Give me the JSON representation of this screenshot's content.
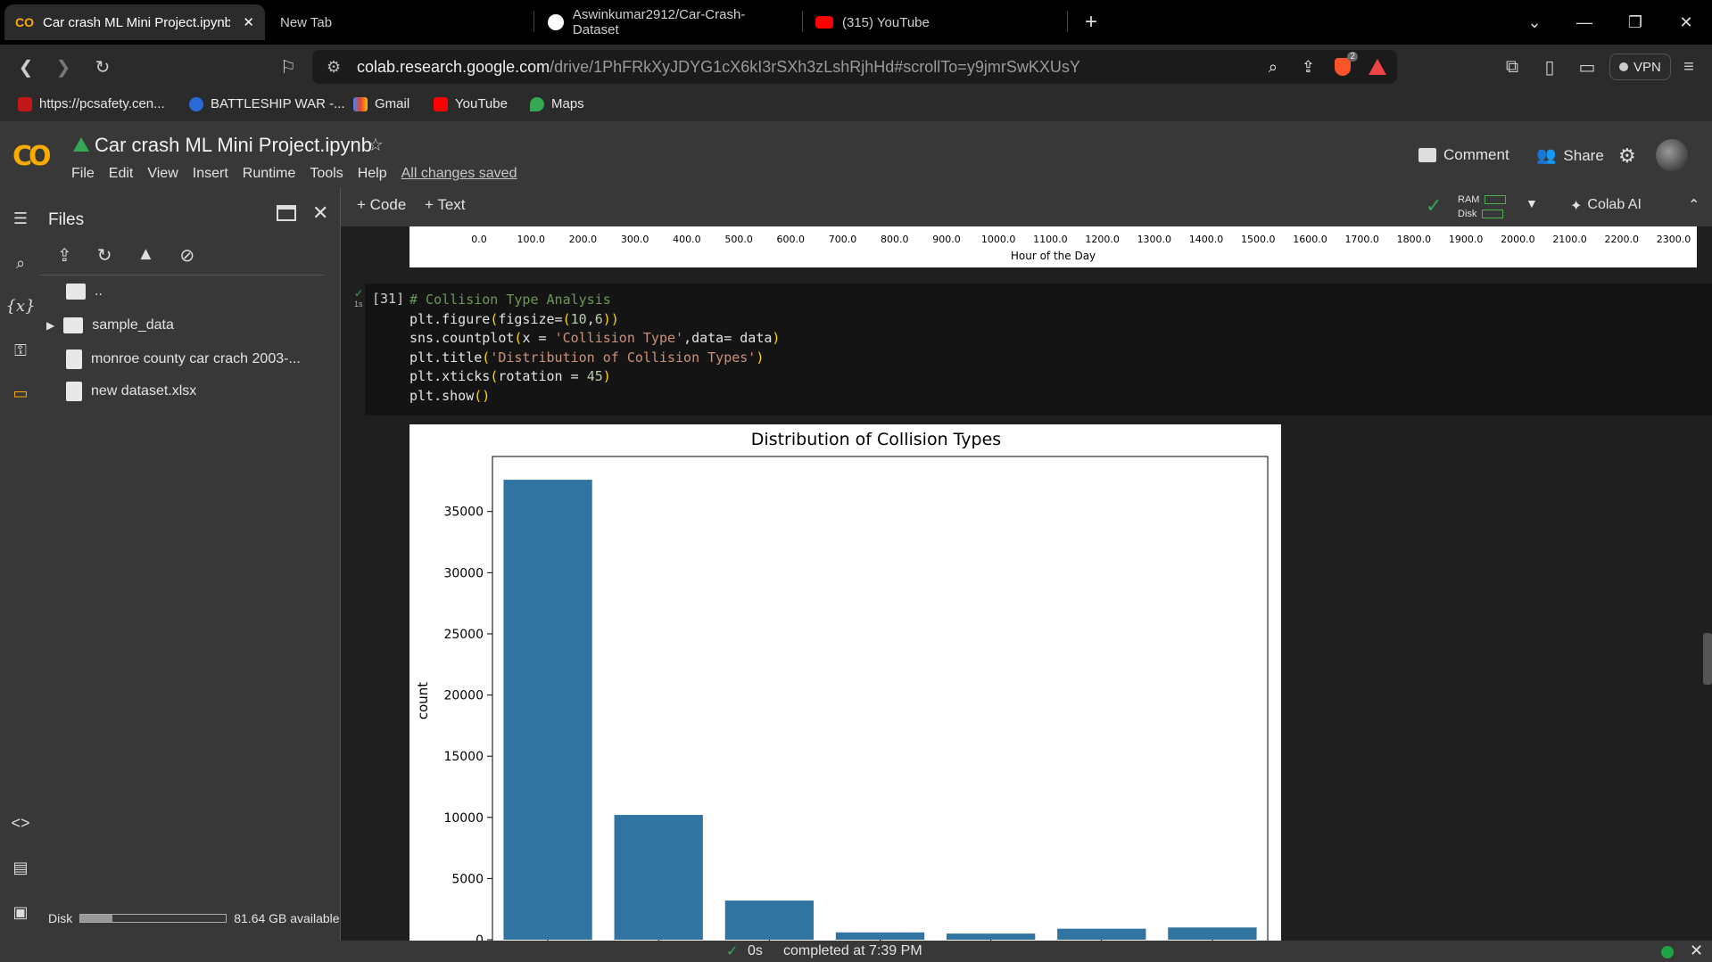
{
  "browser": {
    "tabs": [
      {
        "title": "Car crash ML Mini Project.ipynb",
        "active": true
      },
      {
        "title": "New Tab",
        "active": false
      },
      {
        "title": "Aswinkumar2912/Car-Crash-Dataset",
        "active": false
      },
      {
        "title": "(315) YouTube",
        "active": false
      }
    ],
    "url_host": "colab.research.google.com",
    "url_path": "/drive/1PhFRkXyJDYG1cX6kI3rSXh3zLshRjhHd#scrollTo=y9jmrSwKXUsY",
    "vpn_label": "VPN",
    "shield_badge": "2",
    "bookmarks": [
      "https://pcsafety.cen...",
      "BATTLESHIP WAR -...",
      "Gmail",
      "YouTube",
      "Maps"
    ]
  },
  "colab": {
    "logo": "CO",
    "title": "Car crash ML Mini Project.ipynb",
    "menu": [
      "File",
      "Edit",
      "View",
      "Insert",
      "Runtime",
      "Tools",
      "Help"
    ],
    "saved_status": "All changes saved",
    "comment_label": "Comment",
    "share_label": "Share",
    "toolbar": {
      "code_label": "+ Code",
      "text_label": "+ Text",
      "ram_label": "RAM",
      "disk_label": "Disk",
      "colab_ai_label": "Colab AI"
    }
  },
  "files_panel": {
    "title": "Files",
    "items": [
      {
        "name": "..",
        "type": "parent"
      },
      {
        "name": "sample_data",
        "type": "folder"
      },
      {
        "name": "monroe county car crach 2003-...",
        "type": "file"
      },
      {
        "name": "new dataset.xlsx",
        "type": "file"
      }
    ],
    "disk_label": "Disk",
    "disk_available": "81.64 GB available",
    "disk_used_fraction": 0.22
  },
  "prev_output": {
    "xticks": [
      "0.0",
      "100.0",
      "200.0",
      "300.0",
      "400.0",
      "500.0",
      "600.0",
      "700.0",
      "800.0",
      "900.0",
      "1000.0",
      "1100.0",
      "1200.0",
      "1300.0",
      "1400.0",
      "1500.0",
      "1600.0",
      "1700.0",
      "1800.0",
      "1900.0",
      "2000.0",
      "2100.0",
      "2200.0",
      "2300.0"
    ],
    "xlabel": "Hour of the Day"
  },
  "cell": {
    "exec_count": "[31]",
    "exec_time": "1s"
  },
  "chart_data": {
    "type": "bar",
    "title": "Distribution of Collision Types",
    "xlabel": "",
    "ylabel": "count",
    "ylim": [
      0,
      39500
    ],
    "yticks": [
      0,
      5000,
      10000,
      15000,
      20000,
      25000,
      30000,
      35000
    ],
    "categories": [
      "",
      "",
      "",
      "",
      "",
      "",
      ""
    ],
    "values": [
      37600,
      10200,
      3200,
      600,
      500,
      900,
      1000
    ],
    "bar_color": "#3274a1"
  },
  "status": {
    "time": "0s",
    "completed": "completed at 7:39 PM"
  }
}
